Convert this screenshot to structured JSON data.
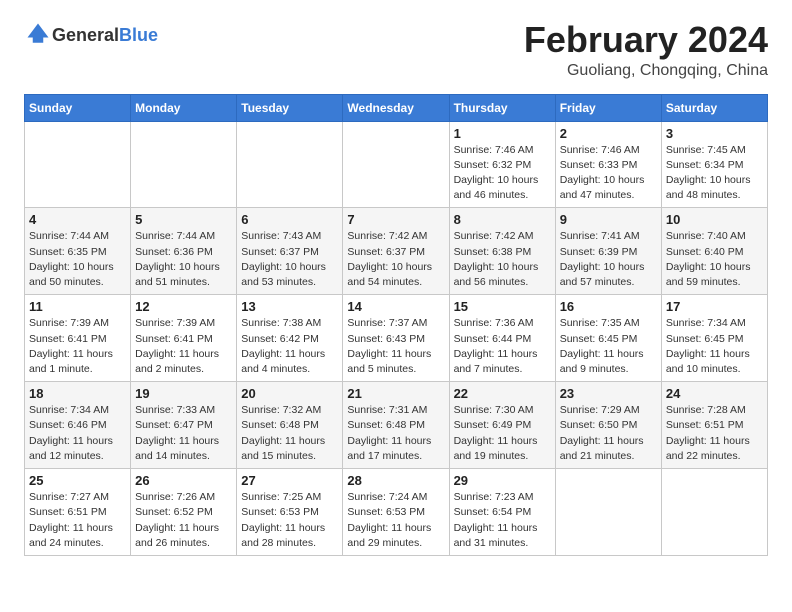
{
  "header": {
    "logo_general": "General",
    "logo_blue": "Blue",
    "month_title": "February 2024",
    "location": "Guoliang, Chongqing, China"
  },
  "weekdays": [
    "Sunday",
    "Monday",
    "Tuesday",
    "Wednesday",
    "Thursday",
    "Friday",
    "Saturday"
  ],
  "weeks": [
    [
      {
        "day": "",
        "info": ""
      },
      {
        "day": "",
        "info": ""
      },
      {
        "day": "",
        "info": ""
      },
      {
        "day": "",
        "info": ""
      },
      {
        "day": "1",
        "info": "Sunrise: 7:46 AM\nSunset: 6:32 PM\nDaylight: 10 hours and 46 minutes."
      },
      {
        "day": "2",
        "info": "Sunrise: 7:46 AM\nSunset: 6:33 PM\nDaylight: 10 hours and 47 minutes."
      },
      {
        "day": "3",
        "info": "Sunrise: 7:45 AM\nSunset: 6:34 PM\nDaylight: 10 hours and 48 minutes."
      }
    ],
    [
      {
        "day": "4",
        "info": "Sunrise: 7:44 AM\nSunset: 6:35 PM\nDaylight: 10 hours and 50 minutes."
      },
      {
        "day": "5",
        "info": "Sunrise: 7:44 AM\nSunset: 6:36 PM\nDaylight: 10 hours and 51 minutes."
      },
      {
        "day": "6",
        "info": "Sunrise: 7:43 AM\nSunset: 6:37 PM\nDaylight: 10 hours and 53 minutes."
      },
      {
        "day": "7",
        "info": "Sunrise: 7:42 AM\nSunset: 6:37 PM\nDaylight: 10 hours and 54 minutes."
      },
      {
        "day": "8",
        "info": "Sunrise: 7:42 AM\nSunset: 6:38 PM\nDaylight: 10 hours and 56 minutes."
      },
      {
        "day": "9",
        "info": "Sunrise: 7:41 AM\nSunset: 6:39 PM\nDaylight: 10 hours and 57 minutes."
      },
      {
        "day": "10",
        "info": "Sunrise: 7:40 AM\nSunset: 6:40 PM\nDaylight: 10 hours and 59 minutes."
      }
    ],
    [
      {
        "day": "11",
        "info": "Sunrise: 7:39 AM\nSunset: 6:41 PM\nDaylight: 11 hours and 1 minute."
      },
      {
        "day": "12",
        "info": "Sunrise: 7:39 AM\nSunset: 6:41 PM\nDaylight: 11 hours and 2 minutes."
      },
      {
        "day": "13",
        "info": "Sunrise: 7:38 AM\nSunset: 6:42 PM\nDaylight: 11 hours and 4 minutes."
      },
      {
        "day": "14",
        "info": "Sunrise: 7:37 AM\nSunset: 6:43 PM\nDaylight: 11 hours and 5 minutes."
      },
      {
        "day": "15",
        "info": "Sunrise: 7:36 AM\nSunset: 6:44 PM\nDaylight: 11 hours and 7 minutes."
      },
      {
        "day": "16",
        "info": "Sunrise: 7:35 AM\nSunset: 6:45 PM\nDaylight: 11 hours and 9 minutes."
      },
      {
        "day": "17",
        "info": "Sunrise: 7:34 AM\nSunset: 6:45 PM\nDaylight: 11 hours and 10 minutes."
      }
    ],
    [
      {
        "day": "18",
        "info": "Sunrise: 7:34 AM\nSunset: 6:46 PM\nDaylight: 11 hours and 12 minutes."
      },
      {
        "day": "19",
        "info": "Sunrise: 7:33 AM\nSunset: 6:47 PM\nDaylight: 11 hours and 14 minutes."
      },
      {
        "day": "20",
        "info": "Sunrise: 7:32 AM\nSunset: 6:48 PM\nDaylight: 11 hours and 15 minutes."
      },
      {
        "day": "21",
        "info": "Sunrise: 7:31 AM\nSunset: 6:48 PM\nDaylight: 11 hours and 17 minutes."
      },
      {
        "day": "22",
        "info": "Sunrise: 7:30 AM\nSunset: 6:49 PM\nDaylight: 11 hours and 19 minutes."
      },
      {
        "day": "23",
        "info": "Sunrise: 7:29 AM\nSunset: 6:50 PM\nDaylight: 11 hours and 21 minutes."
      },
      {
        "day": "24",
        "info": "Sunrise: 7:28 AM\nSunset: 6:51 PM\nDaylight: 11 hours and 22 minutes."
      }
    ],
    [
      {
        "day": "25",
        "info": "Sunrise: 7:27 AM\nSunset: 6:51 PM\nDaylight: 11 hours and 24 minutes."
      },
      {
        "day": "26",
        "info": "Sunrise: 7:26 AM\nSunset: 6:52 PM\nDaylight: 11 hours and 26 minutes."
      },
      {
        "day": "27",
        "info": "Sunrise: 7:25 AM\nSunset: 6:53 PM\nDaylight: 11 hours and 28 minutes."
      },
      {
        "day": "28",
        "info": "Sunrise: 7:24 AM\nSunset: 6:53 PM\nDaylight: 11 hours and 29 minutes."
      },
      {
        "day": "29",
        "info": "Sunrise: 7:23 AM\nSunset: 6:54 PM\nDaylight: 11 hours and 31 minutes."
      },
      {
        "day": "",
        "info": ""
      },
      {
        "day": "",
        "info": ""
      }
    ]
  ]
}
